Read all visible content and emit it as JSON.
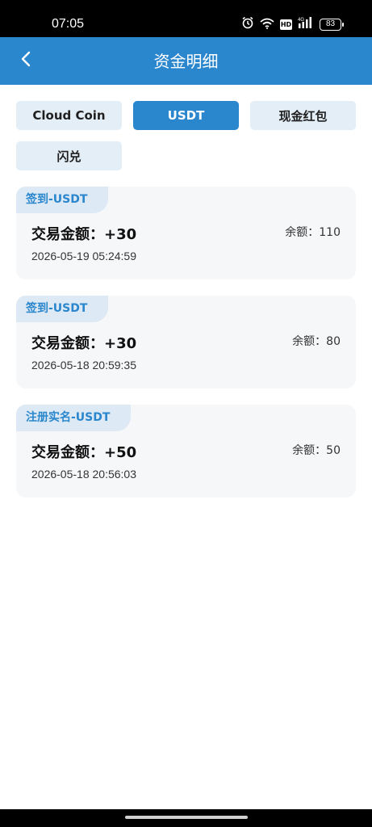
{
  "status_bar": {
    "time": "07:05",
    "battery": "83",
    "hd": "HD",
    "icons": [
      "alarm-icon",
      "wifi-icon",
      "hd-icon",
      "signal-icon",
      "battery-icon"
    ]
  },
  "header": {
    "title": "资金明细",
    "back_icon": "chevron-left-icon",
    "color": "#2a86cd"
  },
  "tabs": [
    {
      "label": "Cloud Coin",
      "active": false
    },
    {
      "label": "USDT",
      "active": true
    },
    {
      "label": "现金红包",
      "active": false
    },
    {
      "label": "闪兑",
      "active": false
    }
  ],
  "records": [
    {
      "tag": "签到-USDT",
      "amount_label": "交易金额：",
      "amount": "+30",
      "date": "2026-05-19 05:24:59",
      "balance_label": "余额：",
      "balance": "110"
    },
    {
      "tag": "签到-USDT",
      "amount_label": "交易金额：",
      "amount": "+30",
      "date": "2026-05-18 20:59:35",
      "balance_label": "余额：",
      "balance": "80"
    },
    {
      "tag": "注册实名-USDT",
      "amount_label": "交易金额：",
      "amount": "+50",
      "date": "2026-05-18 20:56:03",
      "balance_label": "余额：",
      "balance": "50"
    }
  ]
}
